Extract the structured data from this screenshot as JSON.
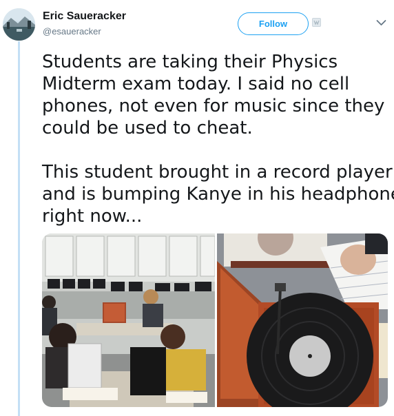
{
  "user": {
    "name": "Eric Saueracker",
    "handle": "@esaueracker"
  },
  "actions": {
    "follow_label": "Follow"
  },
  "tweet": {
    "paragraph1": [
      "Students are taking their Physics",
      "Midterm exam today. I said no cell",
      "phones, not even for music since they",
      "could be used to cheat."
    ],
    "paragraph2": [
      "This student brought in a record player",
      "and is bumping Kanye in his headphones",
      "right now..."
    ]
  },
  "icons": {
    "badge": "notification-badge-icon",
    "menu": "chevron-down-icon"
  },
  "colors": {
    "accent": "#1da1f2",
    "thread_line": "#c4dff5",
    "secondary_text": "#657786"
  }
}
